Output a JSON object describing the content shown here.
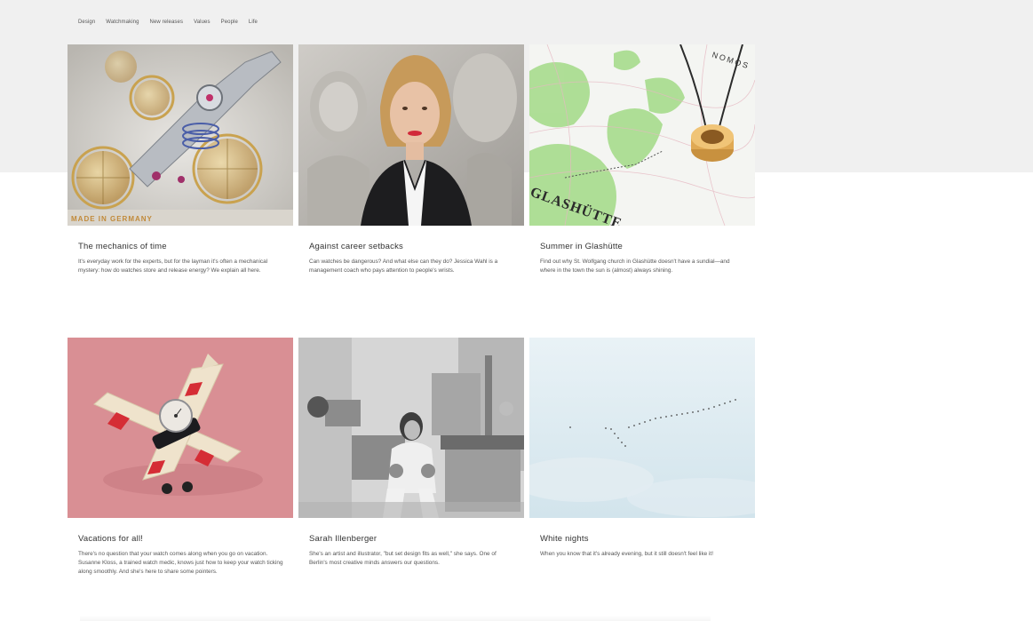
{
  "nav": {
    "items": [
      {
        "label": "Design"
      },
      {
        "label": "Watchmaking"
      },
      {
        "label": "New releases"
      },
      {
        "label": "Values"
      },
      {
        "label": "People"
      },
      {
        "label": "Life"
      }
    ]
  },
  "articles": [
    {
      "title": "The mechanics of time",
      "excerpt": "It's everyday work for the experts, but for the layman it's often a mechanical mystery: how do watches store and release energy? We explain all here.",
      "image_text": "MADE IN GERMANY"
    },
    {
      "title": "Against career setbacks",
      "excerpt": "Can watches be dangerous? And what else can they do? Jessica Wahl is a management coach who pays attention to people's wrists."
    },
    {
      "title": "Summer in Glashütte",
      "excerpt": "Find out why St. Wolfgang church in Glashütte doesn't have a sundial—and where in the town the sun is (almost) always shining.",
      "image_text_map": "GLASHÜTTE",
      "image_text_brand": "NOMOS"
    },
    {
      "title": "Vacations for all!",
      "excerpt": "There's no question that your watch comes along when you go on vacation. Susanne Kloss, a trained watch medic, knows just how to keep your watch ticking along smoothly. And she's here to share some pointers."
    },
    {
      "title": "Sarah Illenberger",
      "excerpt": "She's an artist and illustrator, \"but set design fits as well,\" she says. One of Berlin's most creative minds answers our questions."
    },
    {
      "title": "White nights",
      "excerpt": "When you know that it's already evening, but it still doesn't feel like it!"
    }
  ],
  "colors": {
    "top_band": "#f0f0f0",
    "vacation_bg": "#d98f94",
    "sky_bg": "#dbe9f0"
  }
}
